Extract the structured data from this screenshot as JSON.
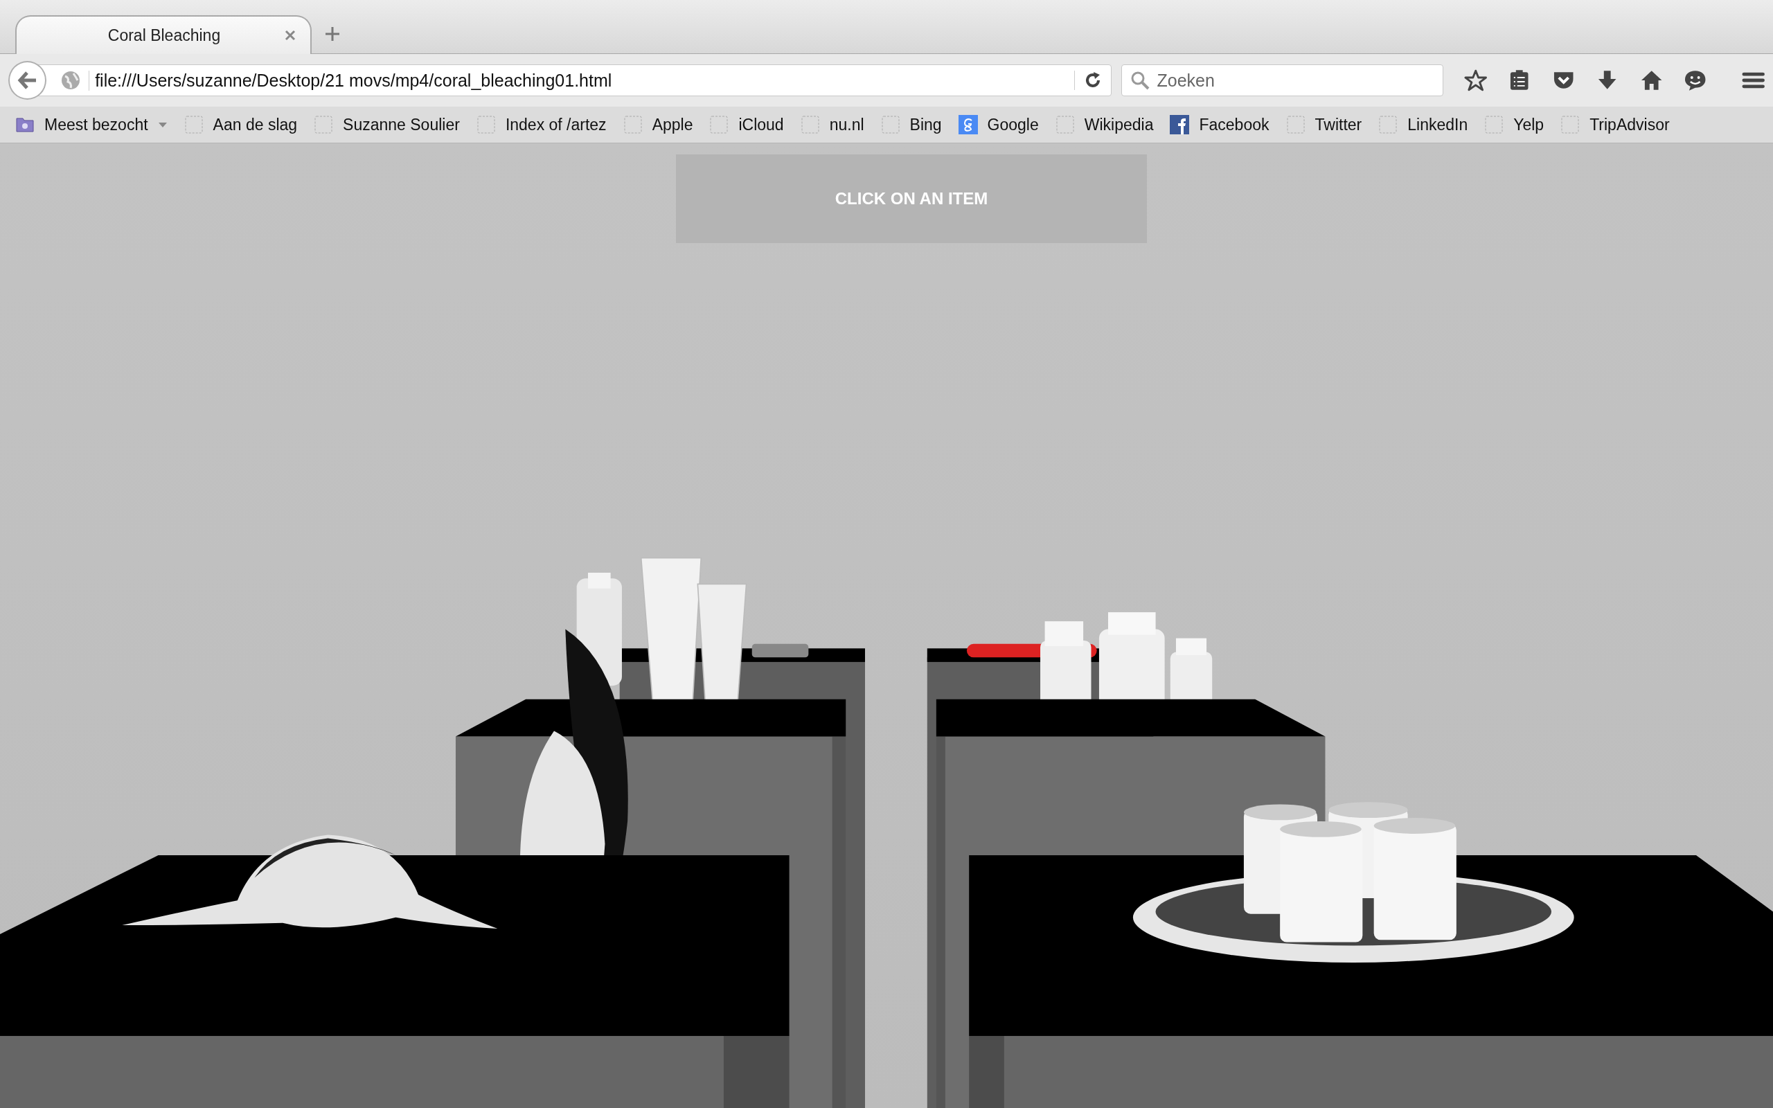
{
  "tab": {
    "title": "Coral Bleaching",
    "selected": true
  },
  "address_bar": {
    "url": "file:///Users/suzanne/Desktop/21 movs/mp4/coral_bleaching01.html"
  },
  "search": {
    "placeholder": "Zoeken"
  },
  "bookmarks": [
    {
      "label": "Meest bezocht",
      "kind": "folder"
    },
    {
      "label": "Aan de slag",
      "kind": "blank"
    },
    {
      "label": "Suzanne Soulier",
      "kind": "blank"
    },
    {
      "label": "Index of /artez",
      "kind": "blank"
    },
    {
      "label": "Apple",
      "kind": "blank"
    },
    {
      "label": "iCloud",
      "kind": "blank"
    },
    {
      "label": "nu.nl",
      "kind": "blank"
    },
    {
      "label": "Bing",
      "kind": "blank"
    },
    {
      "label": "Google",
      "kind": "google"
    },
    {
      "label": "Wikipedia",
      "kind": "blank"
    },
    {
      "label": "Facebook",
      "kind": "facebook"
    },
    {
      "label": "Twitter",
      "kind": "blank"
    },
    {
      "label": "LinkedIn",
      "kind": "blank"
    },
    {
      "label": "Yelp",
      "kind": "blank"
    },
    {
      "label": "TripAdvisor",
      "kind": "blank"
    }
  ],
  "page": {
    "overlay_text": "CLICK ON AN ITEM"
  }
}
